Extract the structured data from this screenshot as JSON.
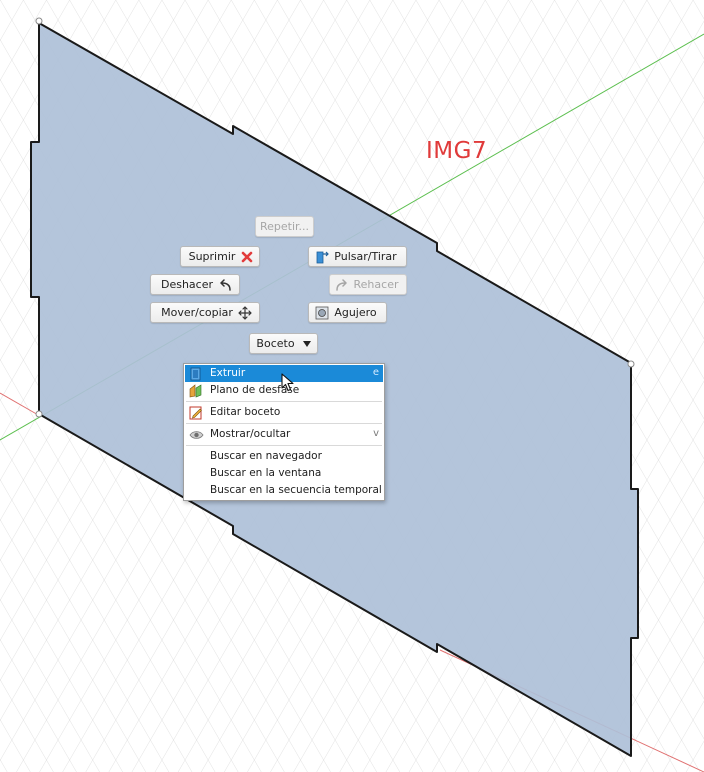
{
  "image_tag": "IMG7",
  "marking_menu": {
    "repeat_label": "Repetir...",
    "delete_label": "Suprimir",
    "press_pull_label": "Pulsar/Tirar",
    "undo_label": "Deshacer",
    "redo_label": "Rehacer",
    "move_copy_label": "Mover/copiar",
    "hole_label": "Agujero",
    "sketch_dropdown_label": "Boceto"
  },
  "context_menu": {
    "items": [
      {
        "label": "Extruir",
        "shortcut": "e",
        "icon": "extrude-icon",
        "highlighted": true
      },
      {
        "label": "Plano de desfase",
        "icon": "offset-plane-icon"
      },
      {
        "label": "Editar boceto",
        "icon": "edit-sketch-icon"
      },
      {
        "label": "Mostrar/ocultar",
        "shortcut": "v",
        "icon": "eye-icon"
      },
      {
        "label": "Buscar en navegador"
      },
      {
        "label": "Buscar en la ventana"
      },
      {
        "label": "Buscar en la secuencia temporal"
      }
    ]
  },
  "colors": {
    "sketch_profile_fill": "#aec0d8",
    "grid_line": "#d9d9d9",
    "axis_green": "#5cbf4f",
    "axis_red": "#e07070",
    "highlight": "#1b8ad8",
    "tag_red": "#e03a3a"
  }
}
